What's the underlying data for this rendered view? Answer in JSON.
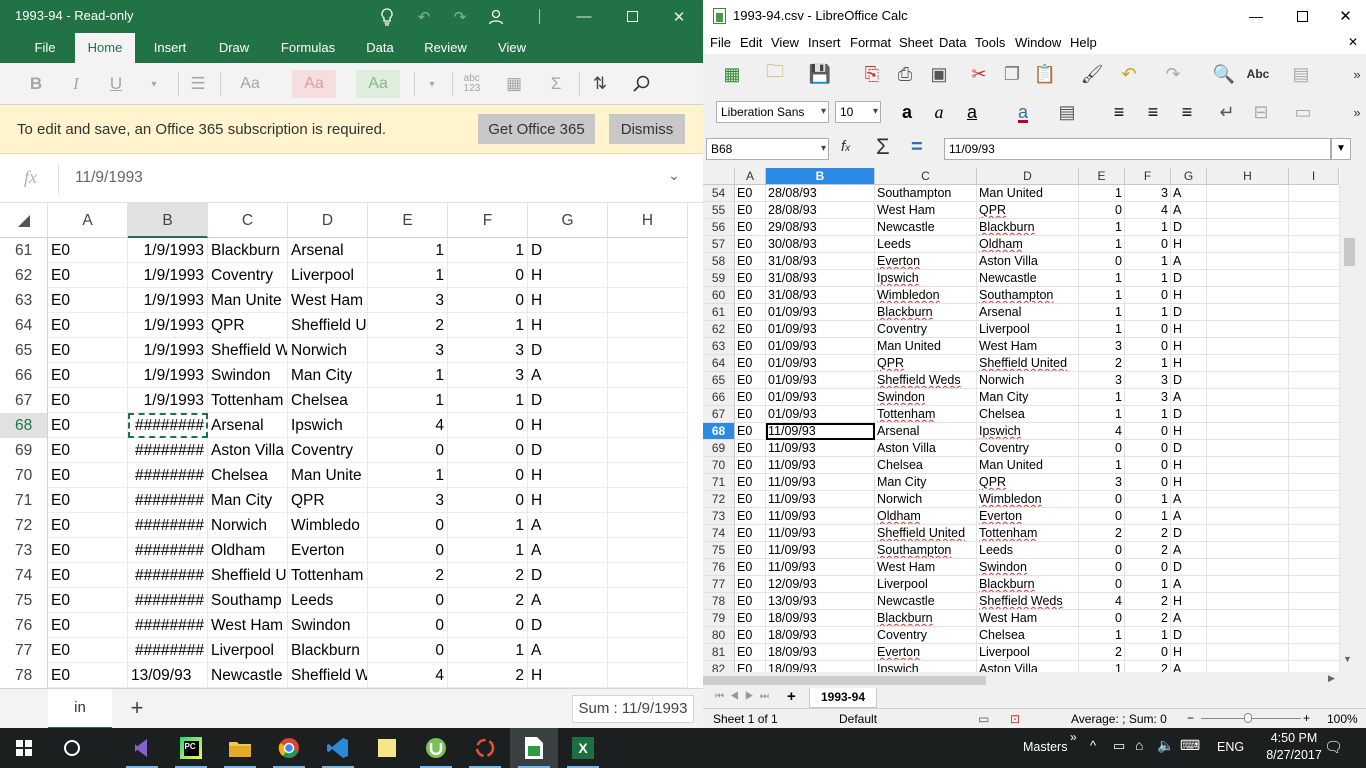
{
  "excel": {
    "title": "1993-94 - Read-only",
    "tabs": [
      "File",
      "Home",
      "Insert",
      "Draw",
      "Formulas",
      "Data",
      "Review",
      "View"
    ],
    "active_tab": "Home",
    "message": "To edit and save, an Office 365 subscription is required.",
    "get_button": "Get Office 365",
    "dismiss_button": "Dismiss",
    "fx": "fx",
    "formula": "11/9/1993",
    "columns": [
      "A",
      "B",
      "C",
      "D",
      "E",
      "F",
      "G",
      "H"
    ],
    "rows": [
      {
        "n": "61",
        "a": "E0",
        "b": "1/9/1993",
        "c": "Blackburn",
        "d": "Arsenal",
        "e": "1",
        "f": "1",
        "g": "D"
      },
      {
        "n": "62",
        "a": "E0",
        "b": "1/9/1993",
        "c": "Coventry",
        "d": "Liverpool",
        "e": "1",
        "f": "0",
        "g": "H"
      },
      {
        "n": "63",
        "a": "E0",
        "b": "1/9/1993",
        "c": "Man Unite",
        "d": "West Ham",
        "e": "3",
        "f": "0",
        "g": "H"
      },
      {
        "n": "64",
        "a": "E0",
        "b": "1/9/1993",
        "c": "QPR",
        "d": "Sheffield U",
        "e": "2",
        "f": "1",
        "g": "H"
      },
      {
        "n": "65",
        "a": "E0",
        "b": "1/9/1993",
        "c": "Sheffield W",
        "d": "Norwich",
        "e": "3",
        "f": "3",
        "g": "D"
      },
      {
        "n": "66",
        "a": "E0",
        "b": "1/9/1993",
        "c": "Swindon",
        "d": "Man City",
        "e": "1",
        "f": "3",
        "g": "A"
      },
      {
        "n": "67",
        "a": "E0",
        "b": "1/9/1993",
        "c": "Tottenham",
        "d": "Chelsea",
        "e": "1",
        "f": "1",
        "g": "D"
      },
      {
        "n": "68",
        "a": "E0",
        "b": "########",
        "c": "Arsenal",
        "d": "Ipswich",
        "e": "4",
        "f": "0",
        "g": "H"
      },
      {
        "n": "69",
        "a": "E0",
        "b": "########",
        "c": "Aston Villa",
        "d": "Coventry",
        "e": "0",
        "f": "0",
        "g": "D"
      },
      {
        "n": "70",
        "a": "E0",
        "b": "########",
        "c": "Chelsea",
        "d": "Man Unite",
        "e": "1",
        "f": "0",
        "g": "H"
      },
      {
        "n": "71",
        "a": "E0",
        "b": "########",
        "c": "Man City",
        "d": "QPR",
        "e": "3",
        "f": "0",
        "g": "H"
      },
      {
        "n": "72",
        "a": "E0",
        "b": "########",
        "c": "Norwich",
        "d": "Wimbledo",
        "e": "0",
        "f": "1",
        "g": "A"
      },
      {
        "n": "73",
        "a": "E0",
        "b": "########",
        "c": "Oldham",
        "d": "Everton",
        "e": "0",
        "f": "1",
        "g": "A"
      },
      {
        "n": "74",
        "a": "E0",
        "b": "########",
        "c": "Sheffield U",
        "d": "Tottenham",
        "e": "2",
        "f": "2",
        "g": "D"
      },
      {
        "n": "75",
        "a": "E0",
        "b": "########",
        "c": "Southamp",
        "d": "Leeds",
        "e": "0",
        "f": "2",
        "g": "A"
      },
      {
        "n": "76",
        "a": "E0",
        "b": "########",
        "c": "West Ham",
        "d": "Swindon",
        "e": "0",
        "f": "0",
        "g": "D"
      },
      {
        "n": "77",
        "a": "E0",
        "b": "########",
        "c": "Liverpool",
        "d": "Blackburn",
        "e": "0",
        "f": "1",
        "g": "A"
      },
      {
        "n": "78",
        "a": "E0",
        "b": "13/09/93",
        "c": "Newcastle",
        "d": "Sheffield W",
        "e": "4",
        "f": "2",
        "g": "H"
      }
    ],
    "sheet_tab": "in",
    "sum": "Sum : 11/9/1993"
  },
  "lo": {
    "title": "1993-94.csv - LibreOffice Calc",
    "menu": [
      "File",
      "Edit",
      "View",
      "Insert",
      "Format",
      "Sheet",
      "Data",
      "Tools",
      "Window",
      "Help"
    ],
    "font_name": "Liberation Sans",
    "font_size": "10",
    "cell_ref": "B68",
    "formula": "11/09/93",
    "columns": [
      "A",
      "B",
      "C",
      "D",
      "E",
      "F",
      "G",
      "H",
      "I"
    ],
    "rows": [
      {
        "n": "54",
        "a": "E0",
        "b": "28/08/93",
        "c": "Southampton",
        "d": "Man United",
        "e": "1",
        "f": "3",
        "g": "A"
      },
      {
        "n": "55",
        "a": "E0",
        "b": "28/08/93",
        "c": "West Ham",
        "d": "QPR",
        "e": "0",
        "f": "4",
        "g": "A"
      },
      {
        "n": "56",
        "a": "E0",
        "b": "29/08/93",
        "c": "Newcastle",
        "d": "Blackburn",
        "e": "1",
        "f": "1",
        "g": "D"
      },
      {
        "n": "57",
        "a": "E0",
        "b": "30/08/93",
        "c": "Leeds",
        "d": "Oldham",
        "e": "1",
        "f": "0",
        "g": "H"
      },
      {
        "n": "58",
        "a": "E0",
        "b": "31/08/93",
        "c": "Everton",
        "d": "Aston Villa",
        "e": "0",
        "f": "1",
        "g": "A"
      },
      {
        "n": "59",
        "a": "E0",
        "b": "31/08/93",
        "c": "Ipswich",
        "d": "Newcastle",
        "e": "1",
        "f": "1",
        "g": "D"
      },
      {
        "n": "60",
        "a": "E0",
        "b": "31/08/93",
        "c": "Wimbledon",
        "d": "Southampton",
        "e": "1",
        "f": "0",
        "g": "H"
      },
      {
        "n": "61",
        "a": "E0",
        "b": "01/09/93",
        "c": "Blackburn",
        "d": "Arsenal",
        "e": "1",
        "f": "1",
        "g": "D"
      },
      {
        "n": "62",
        "a": "E0",
        "b": "01/09/93",
        "c": "Coventry",
        "d": "Liverpool",
        "e": "1",
        "f": "0",
        "g": "H"
      },
      {
        "n": "63",
        "a": "E0",
        "b": "01/09/93",
        "c": "Man United",
        "d": "West Ham",
        "e": "3",
        "f": "0",
        "g": "H"
      },
      {
        "n": "64",
        "a": "E0",
        "b": "01/09/93",
        "c": "QPR",
        "d": "Sheffield United",
        "e": "2",
        "f": "1",
        "g": "H"
      },
      {
        "n": "65",
        "a": "E0",
        "b": "01/09/93",
        "c": "Sheffield Weds",
        "d": "Norwich",
        "e": "3",
        "f": "3",
        "g": "D"
      },
      {
        "n": "66",
        "a": "E0",
        "b": "01/09/93",
        "c": "Swindon",
        "d": "Man City",
        "e": "1",
        "f": "3",
        "g": "A"
      },
      {
        "n": "67",
        "a": "E0",
        "b": "01/09/93",
        "c": "Tottenham",
        "d": "Chelsea",
        "e": "1",
        "f": "1",
        "g": "D"
      },
      {
        "n": "68",
        "a": "E0",
        "b": "11/09/93",
        "c": "Arsenal",
        "d": "Ipswich",
        "e": "4",
        "f": "0",
        "g": "H"
      },
      {
        "n": "69",
        "a": "E0",
        "b": "11/09/93",
        "c": "Aston Villa",
        "d": "Coventry",
        "e": "0",
        "f": "0",
        "g": "D"
      },
      {
        "n": "70",
        "a": "E0",
        "b": "11/09/93",
        "c": "Chelsea",
        "d": "Man United",
        "e": "1",
        "f": "0",
        "g": "H"
      },
      {
        "n": "71",
        "a": "E0",
        "b": "11/09/93",
        "c": "Man City",
        "d": "QPR",
        "e": "3",
        "f": "0",
        "g": "H"
      },
      {
        "n": "72",
        "a": "E0",
        "b": "11/09/93",
        "c": "Norwich",
        "d": "Wimbledon",
        "e": "0",
        "f": "1",
        "g": "A"
      },
      {
        "n": "73",
        "a": "E0",
        "b": "11/09/93",
        "c": "Oldham",
        "d": "Everton",
        "e": "0",
        "f": "1",
        "g": "A"
      },
      {
        "n": "74",
        "a": "E0",
        "b": "11/09/93",
        "c": "Sheffield United",
        "d": "Tottenham",
        "e": "2",
        "f": "2",
        "g": "D"
      },
      {
        "n": "75",
        "a": "E0",
        "b": "11/09/93",
        "c": "Southampton",
        "d": "Leeds",
        "e": "0",
        "f": "2",
        "g": "A"
      },
      {
        "n": "76",
        "a": "E0",
        "b": "11/09/93",
        "c": "West Ham",
        "d": "Swindon",
        "e": "0",
        "f": "0",
        "g": "D"
      },
      {
        "n": "77",
        "a": "E0",
        "b": "12/09/93",
        "c": "Liverpool",
        "d": "Blackburn",
        "e": "0",
        "f": "1",
        "g": "A"
      },
      {
        "n": "78",
        "a": "E0",
        "b": "13/09/93",
        "c": "Newcastle",
        "d": "Sheffield Weds",
        "e": "4",
        "f": "2",
        "g": "H"
      },
      {
        "n": "79",
        "a": "E0",
        "b": "18/09/93",
        "c": "Blackburn",
        "d": "West Ham",
        "e": "0",
        "f": "2",
        "g": "A"
      },
      {
        "n": "80",
        "a": "E0",
        "b": "18/09/93",
        "c": "Coventry",
        "d": "Chelsea",
        "e": "1",
        "f": "1",
        "g": "D"
      },
      {
        "n": "81",
        "a": "E0",
        "b": "18/09/93",
        "c": "Everton",
        "d": "Liverpool",
        "e": "2",
        "f": "0",
        "g": "H"
      },
      {
        "n": "82",
        "a": "E0",
        "b": "18/09/93",
        "c": "Ipswich",
        "d": "Aston Villa",
        "e": "1",
        "f": "2",
        "g": "A"
      }
    ],
    "sheet_tab": "1993-94",
    "status_sheet": "Sheet 1 of 1",
    "status_style": "Default",
    "status_sum": "Average: ; Sum: 0",
    "zoom": "100%"
  },
  "taskbar": {
    "masters": "Masters",
    "lang": "ENG",
    "time": "4:50 PM",
    "date": "8/27/2017"
  },
  "colors": {
    "excel_green": "#217346",
    "lo_selection": "#2a8ae4",
    "taskbar": "#1b1f20"
  }
}
